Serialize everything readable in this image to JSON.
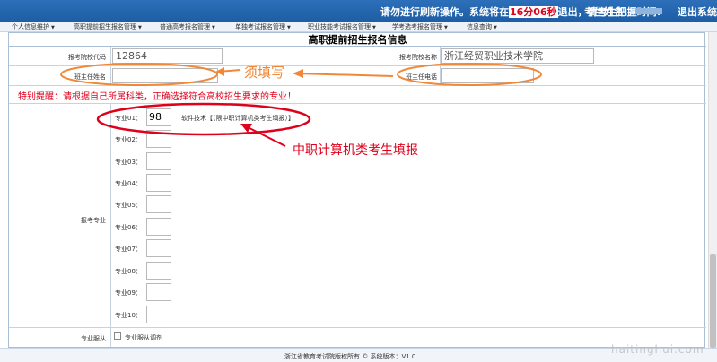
{
  "header": {
    "notice_before": "请勿进行刷新操作。系统将在",
    "countdown": "16分06秒",
    "notice_after": "退出，请考生把握时间!",
    "exam_label": "考生姓名:",
    "logout": "退出系统"
  },
  "menu": [
    "个人信息维护",
    "高职提前招生报名管理",
    "普通高考报名管理",
    "单独考试报名管理",
    "职业技能考试报名管理",
    "学考选考报名管理",
    "信息查询"
  ],
  "form": {
    "title": "高职提前招生报名信息",
    "school_code_label": "报考院校代码",
    "school_code": "12864",
    "school_name_label": "报考院校名称",
    "school_name": "浙江经贸职业技术学院",
    "teacher_name_label": "班主任姓名",
    "teacher_name": "",
    "teacher_phone_label": "班主任电话",
    "teacher_phone": "",
    "warning": "特别提醒：请根据自己所属科类，正确选择符合高校招生要求的专业！",
    "majors_label": "报考专业",
    "majors": [
      {
        "label": "专业01：",
        "value": "98",
        "name": "软件技术【（限中职计算机类考生填报）】"
      },
      {
        "label": "专业02：",
        "value": "",
        "name": ""
      },
      {
        "label": "专业03：",
        "value": "",
        "name": ""
      },
      {
        "label": "专业04：",
        "value": "",
        "name": ""
      },
      {
        "label": "专业05：",
        "value": "",
        "name": ""
      },
      {
        "label": "专业06：",
        "value": "",
        "name": ""
      },
      {
        "label": "专业07：",
        "value": "",
        "name": ""
      },
      {
        "label": "专业08：",
        "value": "",
        "name": ""
      },
      {
        "label": "专业09：",
        "value": "",
        "name": ""
      },
      {
        "label": "专业10：",
        "value": "",
        "name": ""
      }
    ],
    "adjust_label": "专业服从",
    "adjust_checkbox_label": "专业服从调剂"
  },
  "annotations": {
    "required": "须填写",
    "note": "中职计算机类考生填报",
    "orange": "#f0883a",
    "red": "#e0001b"
  },
  "footer": {
    "copyright": "浙江省教育考试院版权所有 ©    系统版本：V1.0"
  },
  "watermark": "haitinghui.com"
}
